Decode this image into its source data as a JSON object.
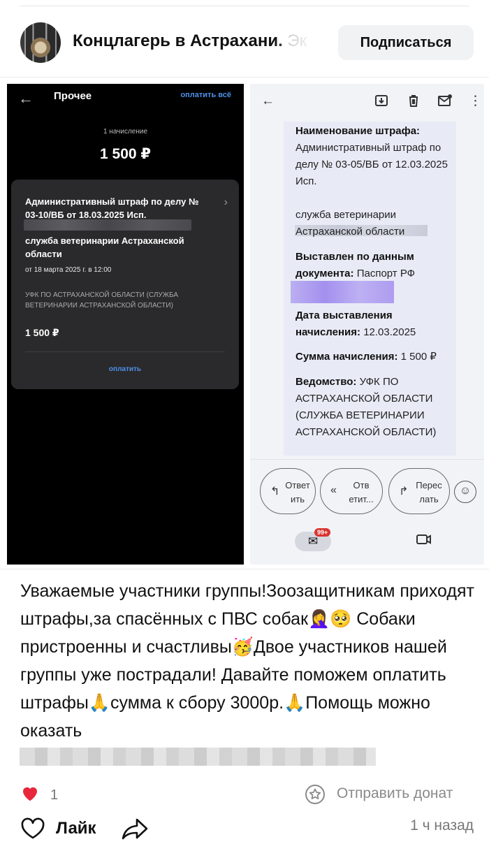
{
  "header": {
    "group_title": "Концлагерь в Астрахани.",
    "group_title_overflow": " Эк",
    "subscribe_label": "Подписаться"
  },
  "left_screenshot": {
    "title": "Прочее",
    "pay_all": "оплатить всё",
    "count_label": "1 начисление",
    "total": "1 500 ₽",
    "fine": {
      "title": "Административный штраф по делу № 03-10/ВБ от 18.03.2025 Исп.",
      "service": "служба ветеринарии Астраханской области",
      "date": "от 18 марта 2025 г. в 12:00",
      "recipient": "УФК ПО АСТРАХАНСКОЙ ОБЛАСТИ (СЛУЖБА ВЕТЕРИНАРИИ АСТРАХАНСКОЙ ОБЛАСТИ)",
      "amount": "1 500 ₽",
      "pay_label": "оплатить"
    }
  },
  "right_screenshot": {
    "fine_name_label": "Наименование штрафа:",
    "fine_name_value": "Административный штраф по делу № 03-05/ВБ от 12.03.2025 Исп.",
    "fine_name_service": "служба ветеринарии Астраханской области",
    "issued_label": "Выставлен по данным документа:",
    "issued_value": "Паспорт РФ",
    "date_label": "Дата выставления начисления:",
    "date_value": "12.03.2025",
    "sum_label": "Сумма начисления:",
    "sum_value": "1 500 ₽",
    "dept_label": "Ведомство:",
    "dept_value": "УФК ПО АСТРАХАНСКОЙ ОБЛАСТИ (СЛУЖБА ВЕТЕРИНАРИИ АСТРАХАНСКОЙ ОБЛАСТИ)",
    "reply_label_1": "Ответ",
    "reply_label_2": "ить",
    "reply_all_label_1": "Отв",
    "reply_all_label_2": "етит...",
    "forward_label_1": "Перес",
    "forward_label_2": "лать",
    "mail_badge": "99+"
  },
  "post": {
    "text": "Уважаемые участники группы!Зоозащитникам приходят штрафы,за спасённых с ПВС собак🤦‍♀️🥺 Собаки пристроенны и счастливы🥳Двое участников нашей группы уже пострадали! Давайте поможем оплатить штрафы🙏сумма к сбору 3000р.🙏Помощь можно оказать"
  },
  "footer": {
    "reaction_count": "1",
    "donate_label": "Отправить донат",
    "like_label": "Лайк",
    "time_ago": "1 ч назад"
  },
  "colors": {
    "accent_blue": "#4f8fe8",
    "heart_red": "#e8273b",
    "badge_red": "#d8332f"
  }
}
